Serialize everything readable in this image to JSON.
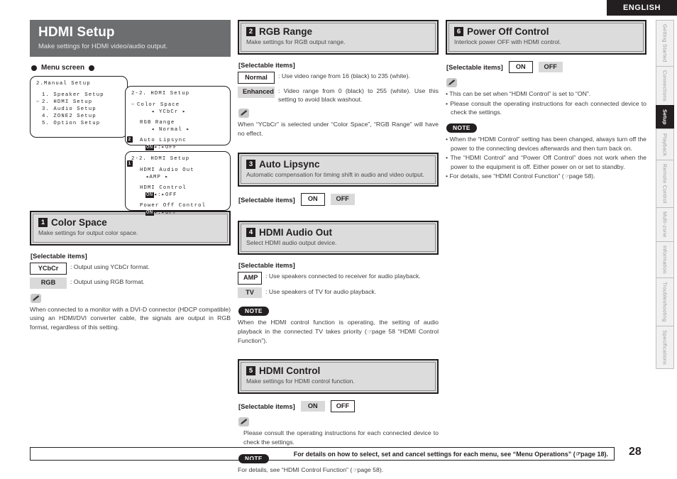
{
  "header": {
    "language_badge": "ENGLISH"
  },
  "side_rail": {
    "tabs": [
      {
        "label": "Getting Started",
        "active": false
      },
      {
        "label": "Connections",
        "active": false
      },
      {
        "label": "Setup",
        "active": true
      },
      {
        "label": "Playback",
        "active": false
      },
      {
        "label": "Remote Control",
        "active": false
      },
      {
        "label": "Multi-zone",
        "active": false
      },
      {
        "label": "Information",
        "active": false
      },
      {
        "label": "Troubleshooting",
        "active": false
      },
      {
        "label": "Specifications",
        "active": false
      }
    ]
  },
  "page_title": {
    "title": "HDMI Setup",
    "subtitle": "Make settings for HDMI video/audio output."
  },
  "menu_screen": {
    "label": "Menu screen",
    "panel_a": {
      "title": "2.Manual Setup",
      "items": [
        {
          "cursor": false,
          "text": "1. Speaker Setup"
        },
        {
          "cursor": true,
          "text": "2. HDMI Setup"
        },
        {
          "cursor": false,
          "text": "3. Audio Setup"
        },
        {
          "cursor": false,
          "text": "4. ZONE2 Setup"
        },
        {
          "cursor": false,
          "text": "5. Option Setup"
        }
      ]
    },
    "panel_b": {
      "title": "2-2. HDMI Setup",
      "badge": "2",
      "rows": [
        {
          "name": "Color Space",
          "cursor": true,
          "value": "YCbCr",
          "style": "arrows"
        },
        {
          "name": "RGB Range",
          "cursor": false,
          "value": "Normal",
          "style": "arrows"
        },
        {
          "name": "Auto Lipsync",
          "cursor": false,
          "on": "ON",
          "off": "OFF",
          "style": "onoff"
        }
      ]
    },
    "panel_c": {
      "title": "2-2. HDMI Setup",
      "badge": "1",
      "rows": [
        {
          "name": "HDMI Audio Out",
          "value": "AMP",
          "style": "arrows"
        },
        {
          "name": "HDMI Control",
          "on": "ON",
          "off": "OFF",
          "style": "onoff"
        },
        {
          "name": "Power Off Control",
          "on": "ON",
          "off": "OFF",
          "style": "onoff"
        }
      ]
    }
  },
  "selectable_items_label": "[Selectable items]",
  "sections": {
    "color_space": {
      "number": "1",
      "title": "Color Space",
      "desc": "Make settings for output color space.",
      "options": [
        {
          "chip": "YCbCr",
          "selected": true,
          "text": ": Output using YCbCr format."
        },
        {
          "chip": "RGB",
          "selected": false,
          "text": ": Output using RGB format."
        }
      ],
      "note_text": "When connected to a monitor with a DVI-D connector (HDCP compatible) using an HDMI/DVI converter cable, the signals are output in RGB format, regardless of this setting."
    },
    "rgb_range": {
      "number": "2",
      "title": "RGB Range",
      "desc": "Make settings for RGB output range.",
      "options": [
        {
          "chip": "Normal",
          "selected": true,
          "text": ": Use video range from 16 (black) to 235 (white)."
        },
        {
          "chip": "Enhanced",
          "selected": false,
          "text": ": Video range from 0 (black) to 255 (white). Use this setting to avoid black washout."
        }
      ],
      "note_text": "When “YCbCr” is selected under “Color Space”, “RGB Range” will have no effect."
    },
    "auto_lipsync": {
      "number": "3",
      "title": "Auto Lipsync",
      "desc": "Automatic compensation for timing shift in audio and video output.",
      "on_label": "ON",
      "off_label": "OFF",
      "selected": "ON"
    },
    "hdmi_audio_out": {
      "number": "4",
      "title": "HDMI Audio Out",
      "desc": "Select HDMI audio output device.",
      "options": [
        {
          "chip": "AMP",
          "selected": true,
          "text": ": Use speakers connected to receiver for audio playback."
        },
        {
          "chip": "TV",
          "selected": false,
          "text": ": Use speakers of TV for audio playback."
        }
      ],
      "note_badge": "NOTE",
      "note_text": "When the HDMI control function is operating, the setting of audio playback in the connected TV takes priority (",
      "note_text_2": "page 58 “HDMI Control Function”)."
    },
    "hdmi_control": {
      "number": "5",
      "title": "HDMI Control",
      "desc": "Make settings for HDMI control function.",
      "on_label": "ON",
      "off_label": "OFF",
      "selected": "OFF",
      "pencil_text": "Please consult the operating instructions for each connected device to check the settings.",
      "note_badge": "NOTE",
      "note_text": "For details, see “HDMI Control Function” (",
      "note_text_2": "page 58)."
    },
    "power_off_control": {
      "number": "6",
      "title": "Power Off Control",
      "desc": "Interlock power OFF with HDMI control.",
      "on_label": "ON",
      "off_label": "OFF",
      "selected": "ON",
      "pencil_bullets": [
        "• This can be set when “HDMI Control” is set to “ON”.",
        "• Please consult the operating instructions for each connected device to check the settings."
      ],
      "note_badge": "NOTE",
      "note_bullets": [
        "• When the “HDMI Control” setting has been changed, always turn off the power to the connecting devices afterwards and then turn back on.",
        "• The “HDMI Control” and “Power Off Control” does not work when the power to the equipment is off. Either power on or set to standby."
      ],
      "note_bullet_last": "• For details, see “HDMI Control Function” (",
      "note_bullet_last_2": "page 58)."
    }
  },
  "footer": {
    "text": "For details on how to select, set and cancel settings for each menu, see “Menu Operations” (",
    "text_2": "page 18).",
    "page_number": "28"
  },
  "colors": {
    "title_bar": "#6d6e70",
    "ink": "#231f20",
    "chip_gray": "#d9d9d9",
    "section_gray": "#dcdcdc"
  }
}
